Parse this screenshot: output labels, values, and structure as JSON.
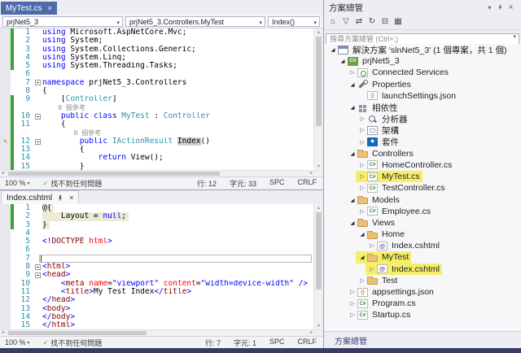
{
  "top_editor": {
    "tab_label": "MyTest.cs",
    "nav": {
      "project": "prjNet5_3",
      "type": "prjNet5_3.Controllers.MyTest",
      "member": "Index()"
    },
    "status": {
      "zoom": "100 %",
      "health": "找不到任何問題",
      "line": "行: 12",
      "col": "字元: 33",
      "spaces": "SPC",
      "eol": "CRLF"
    },
    "lines": [
      {
        "n": "1",
        "chg": true,
        "t": [
          [
            "k",
            "using"
          ],
          [
            "p",
            " Microsoft.AspNetCore.Mvc;"
          ]
        ]
      },
      {
        "n": "2",
        "chg": true,
        "t": [
          [
            "k",
            "using"
          ],
          [
            "p",
            " System;"
          ]
        ]
      },
      {
        "n": "3",
        "chg": true,
        "t": [
          [
            "k",
            "using"
          ],
          [
            "p",
            " System.Collections.Generic;"
          ]
        ]
      },
      {
        "n": "4",
        "chg": true,
        "t": [
          [
            "k",
            "using"
          ],
          [
            "p",
            " System.Linq;"
          ]
        ]
      },
      {
        "n": "5",
        "chg": true,
        "t": [
          [
            "k",
            "using"
          ],
          [
            "p",
            " System.Threading.Tasks;"
          ]
        ]
      },
      {
        "n": "6",
        "t": []
      },
      {
        "n": "7",
        "fold": true,
        "t": [
          [
            "k",
            "namespace"
          ],
          [
            "p",
            " prjNet5_3.Controllers"
          ]
        ]
      },
      {
        "n": "8",
        "t": [
          [
            "p",
            "{"
          ]
        ]
      },
      {
        "n": "9",
        "chg": true,
        "t": [
          [
            "p",
            "    ["
          ],
          [
            "ty",
            "Controller"
          ],
          [
            "p",
            "]"
          ]
        ]
      },
      {
        "cl": true,
        "chg": true,
        "t": [
          [
            "cl",
            "    0 個參考"
          ]
        ]
      },
      {
        "n": "10",
        "chg": true,
        "fold": true,
        "t": [
          [
            "p",
            "    "
          ],
          [
            "k",
            "public"
          ],
          [
            "k",
            " class"
          ],
          [
            "ty",
            " MyTest"
          ],
          [
            "p",
            " : "
          ],
          [
            "ty",
            "Controller"
          ]
        ]
      },
      {
        "n": "11",
        "chg": true,
        "t": [
          [
            "p",
            "    {"
          ]
        ]
      },
      {
        "cl": true,
        "chg": true,
        "t": [
          [
            "cl",
            "        0 個參考"
          ]
        ]
      },
      {
        "n": "12",
        "chg": true,
        "pencil": true,
        "fold": true,
        "t": [
          [
            "p",
            "        "
          ],
          [
            "k",
            "public"
          ],
          [
            "ty",
            " IActionResult"
          ],
          [
            "p",
            " "
          ],
          [
            "hl",
            "Index"
          ],
          [
            "p",
            "()"
          ]
        ]
      },
      {
        "n": "13",
        "chg": true,
        "t": [
          [
            "p",
            "        {"
          ]
        ]
      },
      {
        "n": "14",
        "chg": true,
        "t": [
          [
            "p",
            "            "
          ],
          [
            "k",
            "return"
          ],
          [
            "p",
            " View();"
          ]
        ]
      },
      {
        "n": "15",
        "chg": true,
        "t": [
          [
            "p",
            "        }"
          ]
        ]
      }
    ]
  },
  "bottom_editor": {
    "tab_label": "Index.cshtml",
    "status": {
      "zoom": "100 %",
      "health": "找不到任何問題",
      "line": "行: 7",
      "col": "字元: 1",
      "spaces": "SPC",
      "eol": "CRLF"
    },
    "lines": [
      {
        "n": "1",
        "chg": true,
        "razor": true,
        "t": [
          [
            "p",
            "@{"
          ]
        ]
      },
      {
        "n": "2",
        "chg": true,
        "razor": true,
        "t": [
          [
            "p",
            "    Layout = "
          ],
          [
            "k",
            "null"
          ],
          [
            "p",
            ";"
          ]
        ]
      },
      {
        "n": "3",
        "chg": true,
        "razor": true,
        "t": [
          [
            "p",
            "}"
          ]
        ]
      },
      {
        "n": "4",
        "t": []
      },
      {
        "n": "5",
        "t": [
          [
            "d",
            "<!"
          ],
          [
            "tn",
            "DOCTYPE"
          ],
          [
            "at",
            " html"
          ],
          [
            "d",
            ">"
          ]
        ]
      },
      {
        "n": "6",
        "t": []
      },
      {
        "n": "7",
        "cursor": true,
        "t": []
      },
      {
        "n": "8",
        "fold": true,
        "t": [
          [
            "d",
            "<"
          ],
          [
            "tn",
            "html"
          ],
          [
            "d",
            ">"
          ]
        ]
      },
      {
        "n": "9",
        "fold": true,
        "t": [
          [
            "d",
            "<"
          ],
          [
            "tn",
            "head"
          ],
          [
            "d",
            ">"
          ]
        ]
      },
      {
        "n": "10",
        "t": [
          [
            "p",
            "    "
          ],
          [
            "d",
            "<"
          ],
          [
            "tn",
            "meta"
          ],
          [
            "at",
            " name"
          ],
          [
            "p",
            "="
          ],
          [
            "av",
            "\"viewport\""
          ],
          [
            "at",
            " content"
          ],
          [
            "p",
            "="
          ],
          [
            "av",
            "\"width=device-width\""
          ],
          [
            "d",
            " />"
          ]
        ]
      },
      {
        "n": "11",
        "t": [
          [
            "p",
            "    "
          ],
          [
            "d",
            "<"
          ],
          [
            "tn",
            "title"
          ],
          [
            "d",
            ">"
          ],
          [
            "p",
            "My Test Index"
          ],
          [
            "d",
            "</"
          ],
          [
            "tn",
            "title"
          ],
          [
            "d",
            ">"
          ]
        ]
      },
      {
        "n": "12",
        "t": [
          [
            "d",
            "</"
          ],
          [
            "tn",
            "head"
          ],
          [
            "d",
            ">"
          ]
        ]
      },
      {
        "n": "13",
        "t": [
          [
            "d",
            "<"
          ],
          [
            "tn",
            "body"
          ],
          [
            "d",
            ">"
          ]
        ]
      },
      {
        "n": "14",
        "t": [
          [
            "d",
            "</"
          ],
          [
            "tn",
            "body"
          ],
          [
            "d",
            ">"
          ]
        ]
      },
      {
        "n": "15",
        "t": [
          [
            "d",
            "</"
          ],
          [
            "tn",
            "html"
          ],
          [
            "d",
            ">"
          ]
        ]
      }
    ]
  },
  "solution_explorer": {
    "title": "方案總管",
    "search_placeholder": "搜尋方案總管 (Ctrl+;)",
    "toolbar_icons": [
      "home",
      "filter",
      "sync",
      "refresh",
      "collapse-all",
      "show-all-files"
    ],
    "tab_label": "方案總管",
    "tree": [
      {
        "label": "解決方案 'slnNet5_3' (1 個專案，共 1 個)",
        "indent": 0,
        "arrow": "exp",
        "icon": "sln"
      },
      {
        "label": "prjNet5_3",
        "indent": 1,
        "arrow": "exp",
        "icon": "proj"
      },
      {
        "label": "Connected Services",
        "indent": 2,
        "arrow": "col",
        "icon": "services"
      },
      {
        "label": "Properties",
        "indent": 2,
        "arrow": "exp",
        "icon": "props"
      },
      {
        "label": "launchSettings.json",
        "indent": 3,
        "arrow": "none",
        "icon": "json"
      },
      {
        "label": "相依性",
        "indent": 2,
        "arrow": "exp",
        "icon": "deps"
      },
      {
        "label": "分析器",
        "indent": 3,
        "arrow": "col",
        "icon": "analyzer"
      },
      {
        "label": "架構",
        "indent": 3,
        "arrow": "col",
        "icon": "framework"
      },
      {
        "label": "套件",
        "indent": 3,
        "arrow": "col",
        "icon": "package"
      },
      {
        "label": "Controllers",
        "indent": 2,
        "arrow": "exp",
        "icon": "folder"
      },
      {
        "label": "HomeController.cs",
        "indent": 3,
        "arrow": "col",
        "icon": "cs"
      },
      {
        "label": "MyTest.cs",
        "indent": 3,
        "arrow": "col",
        "icon": "cs",
        "hl": true
      },
      {
        "label": "TestController.cs",
        "indent": 3,
        "arrow": "col",
        "icon": "cs"
      },
      {
        "label": "Models",
        "indent": 2,
        "arrow": "exp",
        "icon": "folder"
      },
      {
        "label": "Employee.cs",
        "indent": 3,
        "arrow": "col",
        "icon": "cs"
      },
      {
        "label": "Views",
        "indent": 2,
        "arrow": "exp",
        "icon": "folder"
      },
      {
        "label": "Home",
        "indent": 3,
        "arrow": "exp",
        "icon": "folder"
      },
      {
        "label": "Index.cshtml",
        "indent": 4,
        "arrow": "col",
        "icon": "razor"
      },
      {
        "label": "MyTest",
        "indent": 3,
        "arrow": "exp",
        "icon": "folder",
        "hl": true
      },
      {
        "label": "Index.cshtml",
        "indent": 4,
        "arrow": "col",
        "icon": "razor",
        "hl": true
      },
      {
        "label": "Test",
        "indent": 3,
        "arrow": "col",
        "icon": "folder"
      },
      {
        "label": "appsettings.json",
        "indent": 2,
        "arrow": "col",
        "icon": "json"
      },
      {
        "label": "Program.cs",
        "indent": 2,
        "arrow": "col",
        "icon": "cs"
      },
      {
        "label": "Startup.cs",
        "indent": 2,
        "arrow": "col",
        "icon": "cs"
      }
    ]
  }
}
